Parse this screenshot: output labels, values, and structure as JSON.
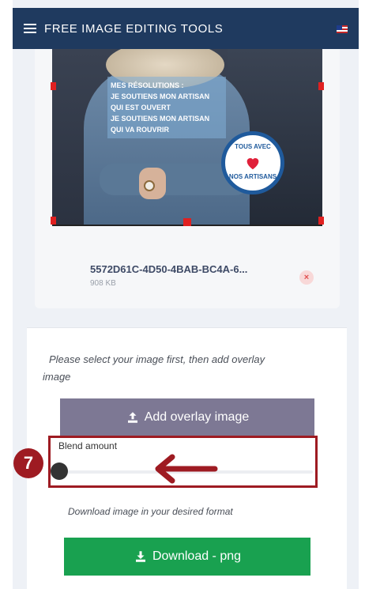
{
  "header": {
    "title": "FREE IMAGE EDITING TOOLS",
    "menu_icon": "hamburger-menu-icon",
    "flag_icon": "us-flag-icon"
  },
  "image_preview": {
    "overlay_lines": [
      "MES RÉSOLUTIONS :",
      "JE SOUTIENS MON ARTISAN",
      "QUI EST OUVERT",
      "JE SOUTIENS MON ARTISAN",
      "QUI VA ROUVRIR"
    ],
    "badge_top": "TOUS AVEC",
    "badge_bottom": "NOS ARTISANS"
  },
  "file": {
    "name": "5572D61C-4D50-4BAB-BC4A-6...",
    "size": "908 KB",
    "remove_icon": "remove-file-icon"
  },
  "instructions": {
    "select_text": "Please select your image first, then add overlay image"
  },
  "buttons": {
    "add_overlay": "Add overlay image",
    "download": "Download - png"
  },
  "blend": {
    "label": "Blend amount",
    "value": 0
  },
  "download_hint": "Download image in your desired format",
  "annotation": {
    "step_number": "7"
  },
  "colors": {
    "header_bg": "#1f3a5f",
    "add_overlay_bg": "#7d7894",
    "download_bg": "#19a150",
    "annotation": "#9e1b22"
  }
}
